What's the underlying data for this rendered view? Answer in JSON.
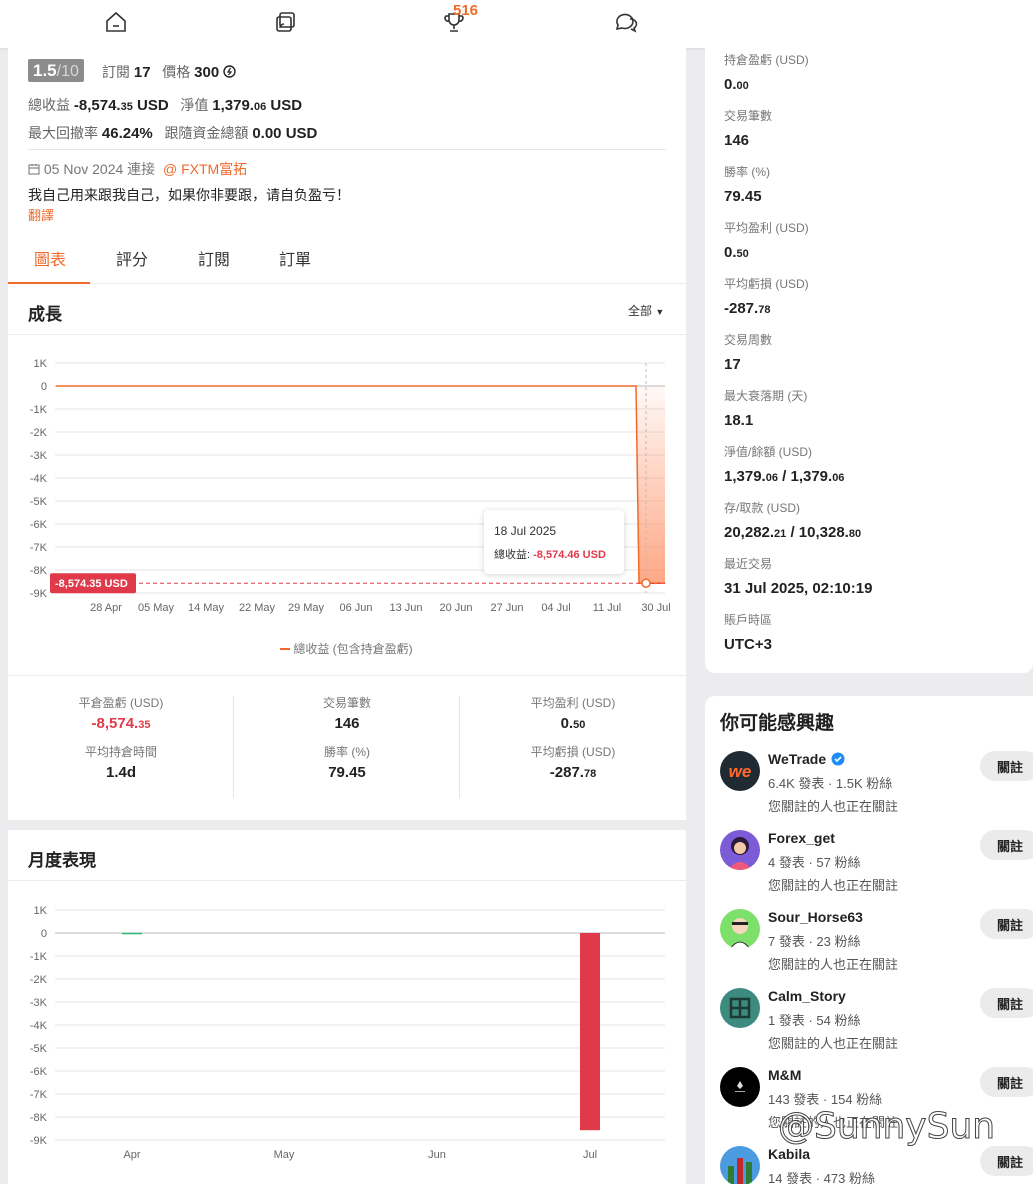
{
  "nav": {
    "badge": "516",
    "icons": [
      "home-icon",
      "copy-trade-icon",
      "trophy-icon",
      "chat-icon"
    ]
  },
  "profile": {
    "rating_value": "1.5",
    "rating_denominator": "/10",
    "subscribe_label": "訂閱",
    "subscribe_count": "17",
    "price_label": "價格",
    "price_value": "300",
    "total_pl_label": "總收益",
    "total_pl_main": "-8,574.",
    "total_pl_dec": "35",
    "total_pl_unit": "USD",
    "equity_label": "淨值",
    "equity_main": "1,379.",
    "equity_dec": "06",
    "equity_unit": "USD",
    "max_dd_label": "最大回撤率",
    "max_dd_value": "46.24%",
    "follow_funds_label": "跟隨資金總額",
    "follow_funds_value": "0.00",
    "follow_funds_unit": "USD",
    "connected_date": "05 Nov 2024 連接",
    "broker": "@ FXTM富拓",
    "description": "我自己用来跟我自己，如果你非要跟，请自负盈亏！",
    "translate_link": "翻譯"
  },
  "tabs": [
    "圖表",
    "評分",
    "訂閱",
    "訂單"
  ],
  "growth": {
    "title": "成長",
    "filter": "全部",
    "legend": "總收益 (包含持倉盈虧)",
    "tooltip_date": "18 Jul 2025",
    "tooltip_label": "總收益:",
    "tooltip_value": "-8,574.46 USD",
    "current_label": "-8,574.35 USD"
  },
  "chart_data": [
    {
      "type": "line",
      "title": "成長",
      "ylim": [
        -9000,
        1000
      ],
      "y_ticks": [
        "1K",
        "0",
        "-1K",
        "-2K",
        "-3K",
        "-4K",
        "-5K",
        "-6K",
        "-7K",
        "-8K",
        "-9K"
      ],
      "x_ticks": [
        "28 Apr",
        "05 May",
        "14 May",
        "22 May",
        "29 May",
        "06 Jun",
        "13 Jun",
        "20 Jun",
        "27 Jun",
        "04 Jul",
        "11 Jul",
        "30 Jul"
      ],
      "series": [
        {
          "name": "總收益 (包含持倉盈虧)",
          "x": [
            "21 Apr",
            "28 Apr",
            "05 May",
            "14 May",
            "22 May",
            "29 May",
            "06 Jun",
            "13 Jun",
            "20 Jun",
            "27 Jun",
            "04 Jul",
            "11 Jul",
            "17 Jul",
            "18 Jul",
            "31 Jul"
          ],
          "values": [
            0,
            0,
            0,
            0,
            0,
            0,
            0,
            0,
            0,
            0,
            0,
            0,
            0,
            -8574.46,
            -8574.35
          ]
        }
      ],
      "annotations": [
        "18 Jul 2025 總收益: -8,574.46 USD",
        "-8,574.35 USD"
      ]
    },
    {
      "type": "bar",
      "title": "月度表現",
      "categories": [
        "Apr",
        "May",
        "Jun",
        "Jul"
      ],
      "y_ticks": [
        "1K",
        "0",
        "-1K",
        "-2K",
        "-3K",
        "-4K",
        "-5K",
        "-6K",
        "-7K",
        "-8K",
        "-9K"
      ],
      "ylim": [
        -9000,
        1000
      ],
      "values": [
        10,
        0,
        0,
        -8574
      ],
      "colors": {
        "positive": "#2eb872",
        "negative": "#e03a4a"
      }
    }
  ],
  "summary": {
    "closed_pl_label": "平倉盈虧 (USD)",
    "closed_pl_main": "-8,574.",
    "closed_pl_dec": "35",
    "trades_label": "交易筆數",
    "trades_value": "146",
    "avg_profit_label": "平均盈利 (USD)",
    "avg_profit_main": "0.",
    "avg_profit_dec": "50",
    "avg_hold_label": "平均持倉時間",
    "avg_hold_value": "1.4d",
    "win_rate_label": "勝率 (%)",
    "win_rate_value": "79.45",
    "avg_loss_label": "平均虧損 (USD)",
    "avg_loss_main": "-287.",
    "avg_loss_dec": "78"
  },
  "monthly": {
    "title": "月度表現"
  },
  "right_stats": [
    {
      "label": "持倉盈虧 (USD)",
      "main": "0.",
      "dec": "00"
    },
    {
      "label": "交易筆數",
      "main": "146",
      "dec": ""
    },
    {
      "label": "勝率 (%)",
      "main": "79.45",
      "dec": ""
    },
    {
      "label": "平均盈利 (USD)",
      "main": "0.",
      "dec": "50"
    },
    {
      "label": "平均虧損 (USD)",
      "main": "-287.",
      "dec": "78"
    },
    {
      "label": "交易周數",
      "main": "17",
      "dec": ""
    },
    {
      "label": "最大衰落期 (天)",
      "main": "18.1",
      "dec": ""
    },
    {
      "label": "淨值/餘額 (USD)",
      "main": "1,379.",
      "dec": "06",
      "main2": " / 1,379.",
      "dec2": "06"
    },
    {
      "label": "存/取款 (USD)",
      "main": "20,282.",
      "dec": "21",
      "main2": " / 10,328.",
      "dec2": "80"
    },
    {
      "label": "最近交易",
      "main": "31 Jul 2025, 02:10:19",
      "dec": ""
    },
    {
      "label": "賬戶時區",
      "main": "UTC+3",
      "dec": ""
    }
  ],
  "suggestions": {
    "title": "你可能感興趣",
    "follow_label": "關註",
    "items": [
      {
        "name": "WeTrade",
        "posts": "6.4K 發表",
        "fans": "1.5K 粉絲",
        "note": "您關註的人也正在關註",
        "verified": true
      },
      {
        "name": "Forex_get",
        "posts": "4 發表",
        "fans": "57 粉絲",
        "note": "您關註的人也正在關註"
      },
      {
        "name": "Sour_Horse63",
        "posts": "7 發表",
        "fans": "23 粉絲",
        "note": "您關註的人也正在關註"
      },
      {
        "name": "Calm_Story",
        "posts": "1 發表",
        "fans": "54 粉絲",
        "note": "您關註的人也正在關註"
      },
      {
        "name": "M&M",
        "posts": "143 發表",
        "fans": "154 粉絲",
        "note": "您關註的人也正在關註"
      },
      {
        "name": "Kabila",
        "posts": "14 發表",
        "fans": "473 粉絲",
        "note": ""
      }
    ]
  },
  "watermark": "@SunnySun"
}
